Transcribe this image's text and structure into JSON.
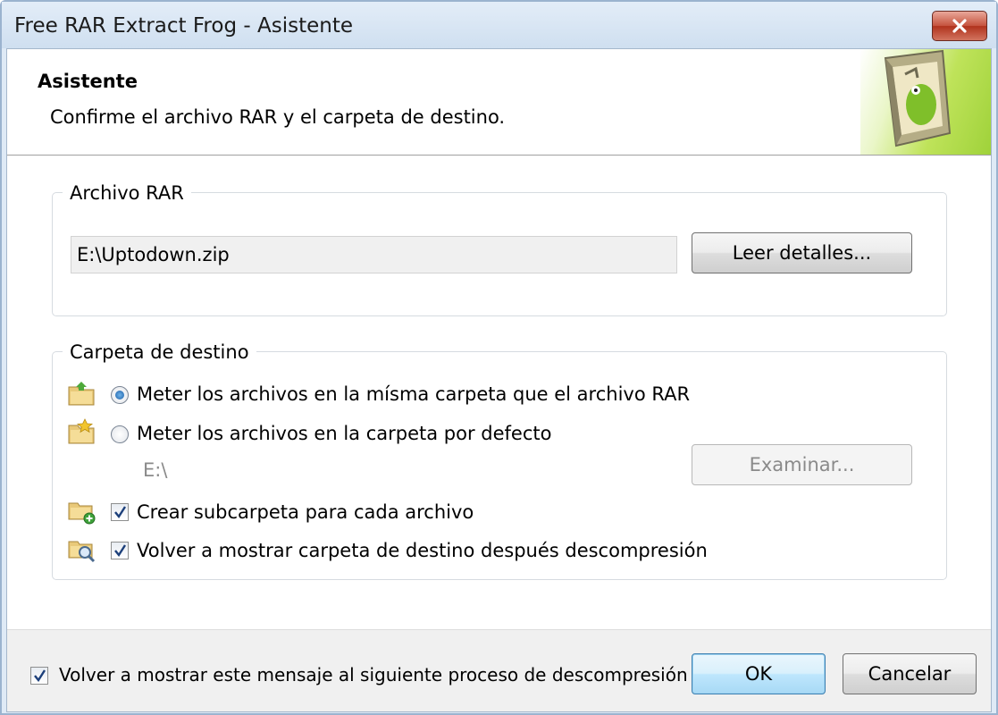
{
  "window": {
    "title": "Free RAR Extract Frog - Asistente"
  },
  "header": {
    "title": "Asistente",
    "subtitle": "Confirme el archivo RAR y el carpeta de destino."
  },
  "rar_group": {
    "label": "Archivo RAR",
    "path_value": "E:\\Uptodown.zip",
    "details_button": "Leer detalles..."
  },
  "dest_group": {
    "label": "Carpeta de destino",
    "option_same": {
      "label": "Meter los archivos en la mísma carpeta que el archivo RAR",
      "selected": true
    },
    "option_default": {
      "label": "Meter los archivos en la carpeta por defecto",
      "selected": false
    },
    "default_path": "E:\\",
    "browse_button": "Examinar...",
    "create_subfolder": {
      "label": "Crear subcarpeta para cada archivo",
      "checked": true
    },
    "show_dest": {
      "label": "Volver a mostrar carpeta de destino después descompresión",
      "checked": true
    }
  },
  "footer": {
    "show_again": {
      "label": "Volver a mostrar este mensaje al siguiente proceso de descompresión",
      "checked": true
    },
    "ok_button": "OK",
    "cancel_button": "Cancelar"
  },
  "icons": [
    "close-icon",
    "wizard-banner-icon",
    "folder-up-icon",
    "folder-star-icon",
    "folder-add-icon",
    "folder-search-icon",
    "checkmark-icon"
  ],
  "colors": {
    "title_bar": "#cfdff0",
    "close_button": "#c5523d",
    "banner_green": "#9fd23a",
    "default_button": "#bee6fd"
  }
}
